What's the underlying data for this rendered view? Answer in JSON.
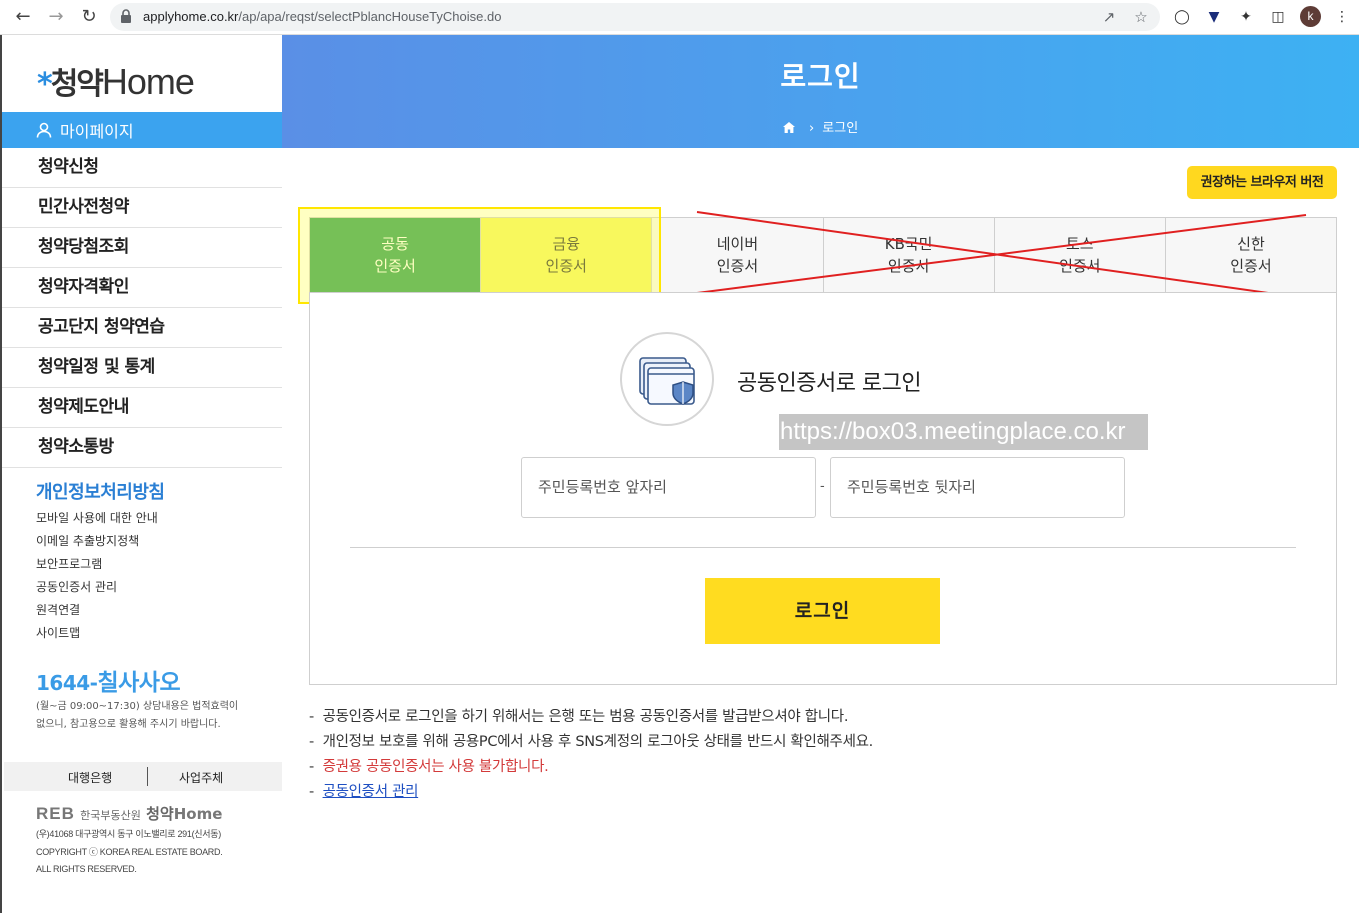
{
  "browser": {
    "url_host": "applyhome.co.kr",
    "url_path": "/ap/apa/reqst/selectPblancHouseTyChoise.do",
    "profile_initial": "k"
  },
  "sidebar": {
    "logo_korean": "청약",
    "logo_english": "Home",
    "mypage_label": "마이페이지",
    "menu": [
      "청약신청",
      "민간사전청약",
      "청약당첨조회",
      "청약자격확인",
      "공고단지 청약연습",
      "청약일정 및 통계",
      "청약제도안내",
      "청약소통방"
    ],
    "privacy_title": "개인정보처리방침",
    "sub_links": [
      "모바일 사용에 대한 안내",
      "이메일 추출방지정책",
      "보안프로그램",
      "공동인증서 관리",
      "원격연결",
      "사이트맵"
    ],
    "phone_prefix": "1644-",
    "phone_word": "칠사사오",
    "phone_note": "(월~금 09:00~17:30) 상담내용은 법적효력이 없으니, 참고용으로 활용해 주시기 바랍니다.",
    "partner_bank": "대행은행",
    "partner_business": "사업주체",
    "footer_reb": "REB",
    "footer_org": "한국부동산원",
    "footer_cheongyak": "청약",
    "footer_home": "Home",
    "footer_address": "(우)41068 대구광역시 동구 이노밸리로 291(신서동)",
    "footer_copyright": "COPYRIGHT ⓒ KOREA REAL ESTATE BOARD.",
    "footer_rights": "ALL RIGHTS RESERVED."
  },
  "banner": {
    "title": "로그인",
    "breadcrumb_current": "로그인"
  },
  "recommend_browser": "권장하는 브라우저 버전",
  "tabs": [
    {
      "line1": "공동",
      "line2": "인증서"
    },
    {
      "line1": "금융",
      "line2": "인증서"
    },
    {
      "line1": "네이버",
      "line2": "인증서"
    },
    {
      "line1": "KB국민",
      "line2": "인증서"
    },
    {
      "line1": "토스",
      "line2": "인증서"
    },
    {
      "line1": "신한",
      "line2": "인증서"
    }
  ],
  "login": {
    "title": "공동인증서로 로그인",
    "watermark": "https://box03.meetingplace.co.kr",
    "front_placeholder": "주민등록번호 앞자리",
    "separator": "-",
    "back_placeholder": "주민등록번호 뒷자리",
    "button": "로그인"
  },
  "notes": [
    "공동인증서로 로그인을 하기 위해서는 은행 또는 범용 공동인증서를 발급받으셔야 합니다.",
    "개인정보 보호를 위해 공용PC에서 사용 후 SNS계정의 로그아웃 상태를 반드시 확인해주세요.",
    "증권용 공동인증서는 사용 불가합니다.",
    "공동인증서 관리"
  ],
  "note_bullet": "-",
  "colors": {
    "accent_blue": "#3ba3ef",
    "active_tab_green": "#2d9f5b",
    "button_yellow": "#ffdc20",
    "highlight_yellow": "#ffe600",
    "cross_red": "#e02020",
    "note_red": "#d33a3a"
  }
}
